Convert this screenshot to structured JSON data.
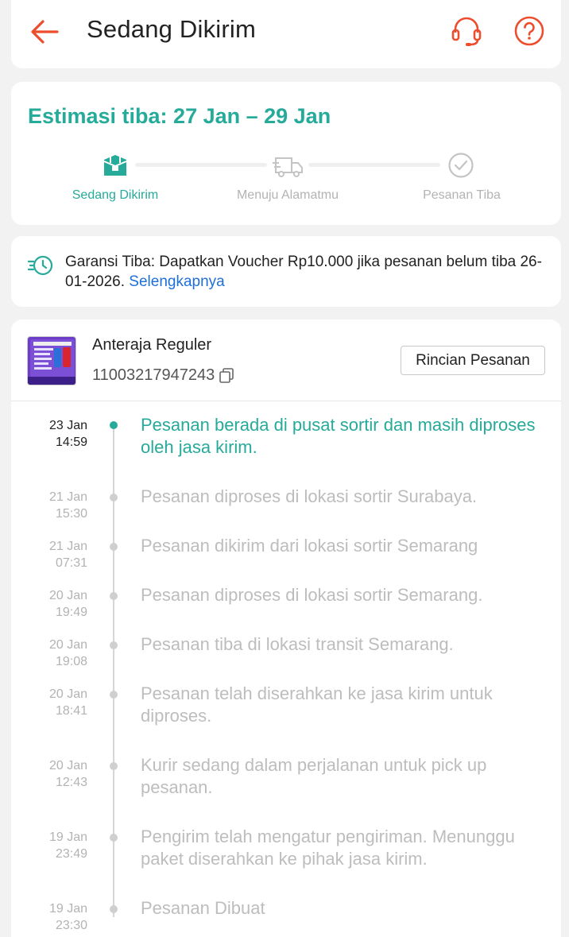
{
  "header": {
    "title": "Sedang Dikirim",
    "icons": [
      "back-arrow-icon",
      "headset-icon",
      "help-icon"
    ],
    "accent_color": "#ee4d2d"
  },
  "estimate": {
    "title": "Estimasi tiba: 27 Jan – 29 Jan",
    "accent_color": "#26aa99",
    "steps": [
      {
        "label": "Sedang Dikirim",
        "icon": "package-icon",
        "active": true
      },
      {
        "label": "Menuju Alamatmu",
        "icon": "truck-icon",
        "active": false
      },
      {
        "label": "Pesanan Tiba",
        "icon": "check-circle-icon",
        "active": false
      }
    ]
  },
  "guarantee": {
    "icon": "clock-fast-icon",
    "text": "Garansi Tiba: Dapatkan Voucher Rp10.000 jika pesanan belum tiba 26-01-2026.",
    "link": "Selengkapnya",
    "link_color": "#1e6fd9"
  },
  "shipment": {
    "courier": "Anteraja Reguler",
    "tracking_number": "11003217947243",
    "detail_button": "Rincian Pesanan",
    "timeline": [
      {
        "date": "23 Jan",
        "time": "14:59",
        "text": "Pesanan berada di pusat sortir dan masih diproses oleh jasa kirim.",
        "active": true
      },
      {
        "date": "21 Jan",
        "time": "15:30",
        "text": "Pesanan diproses di lokasi sortir  Surabaya.",
        "active": false
      },
      {
        "date": "21 Jan",
        "time": "07:31",
        "text": "Pesanan dikirim dari lokasi sortir  Semarang",
        "active": false
      },
      {
        "date": "20 Jan",
        "time": "19:49",
        "text": "Pesanan diproses di lokasi sortir  Semarang.",
        "active": false
      },
      {
        "date": "20 Jan",
        "time": "19:08",
        "text": "Pesanan tiba di lokasi transit  Semarang.",
        "active": false
      },
      {
        "date": "20 Jan",
        "time": "18:41",
        "text": "Pesanan telah diserahkan ke jasa kirim untuk diproses.",
        "active": false
      },
      {
        "date": "20 Jan",
        "time": "12:43",
        "text": "Kurir sedang dalam perjalanan untuk pick up pesanan.",
        "active": false
      },
      {
        "date": "19 Jan",
        "time": "23:49",
        "text": "Pengirim telah mengatur pengiriman. Menunggu paket diserahkan ke pihak jasa kirim.",
        "active": false
      },
      {
        "date": "19 Jan",
        "time": "23:30",
        "text": "Pesanan Dibuat",
        "active": false
      }
    ]
  }
}
